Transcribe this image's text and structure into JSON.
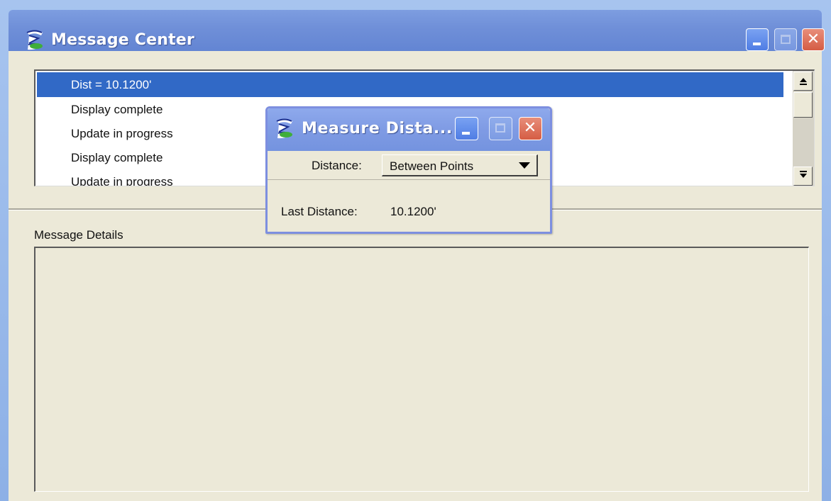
{
  "main_window": {
    "title": "Message Center",
    "messages": [
      {
        "text": "Dist = 10.1200'",
        "selected": true
      },
      {
        "text": "Display complete",
        "selected": false
      },
      {
        "text": "Update in progress",
        "selected": false
      },
      {
        "text": "Display complete",
        "selected": false
      },
      {
        "text": "Update in progress",
        "selected": false
      }
    ],
    "details_label": "Message Details",
    "details_text": ""
  },
  "dialog": {
    "title": "Measure Dista...",
    "distance_label": "Distance:",
    "distance_mode": "Between Points",
    "last_distance_label": "Last Distance:",
    "last_distance_value": "10.1200'"
  },
  "icons": {
    "app": "microstation-logo-icon",
    "minimize": "minimize-icon",
    "maximize": "maximize-icon",
    "close": "close-icon",
    "scroll_up": "scroll-up-arrow-icon",
    "scroll_down": "scroll-down-arrow-icon",
    "dropdown": "dropdown-arrow-icon"
  },
  "colors": {
    "titlebar": "#6f8fd8",
    "selection": "#3169c6",
    "face": "#ece9d8",
    "close_button": "#d55d44"
  }
}
